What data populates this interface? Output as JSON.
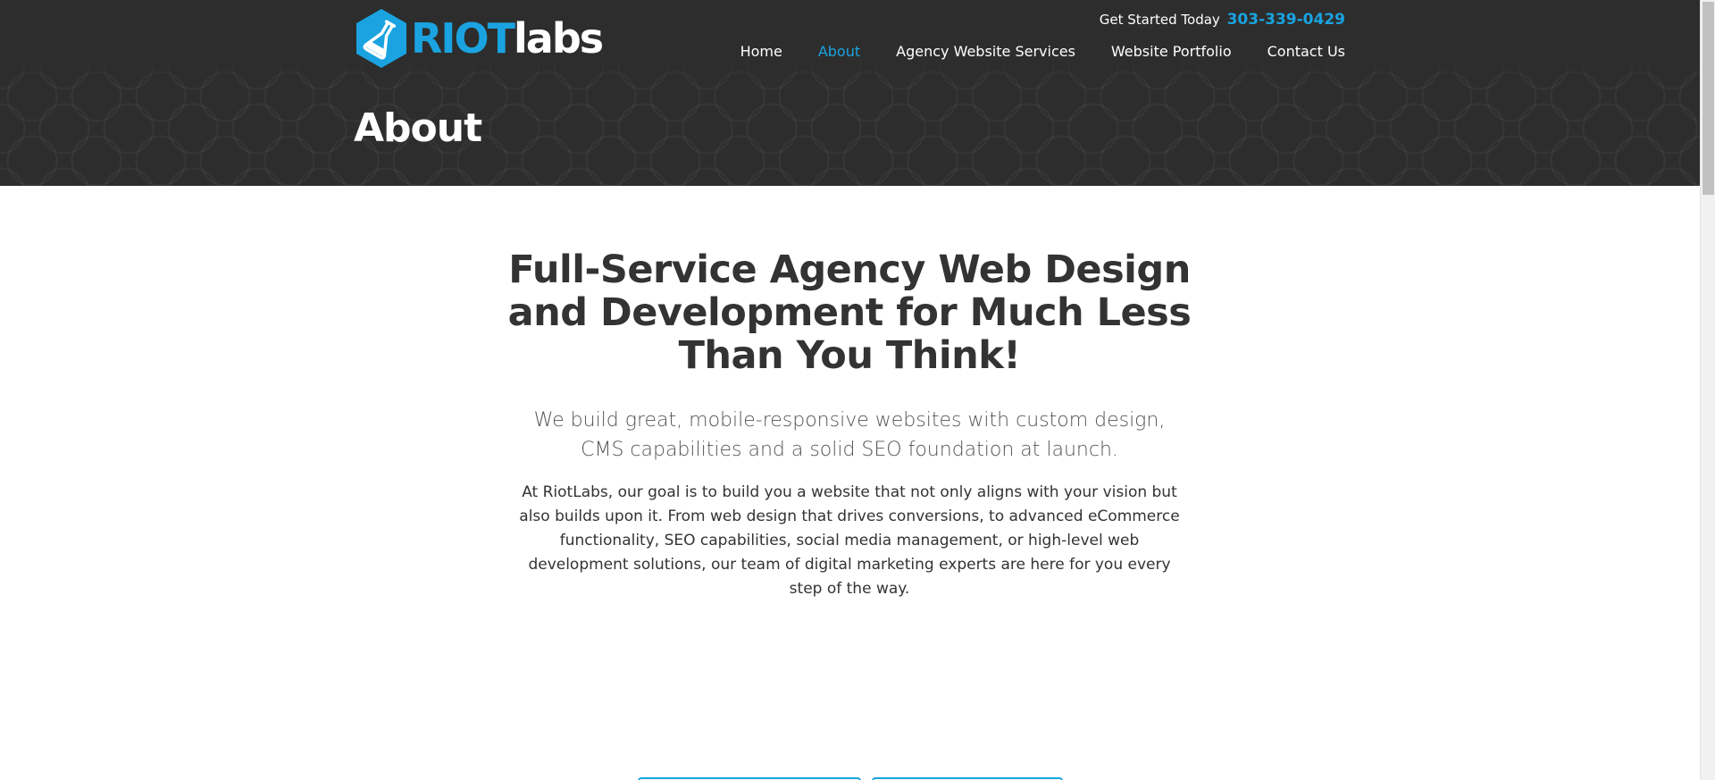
{
  "brand": {
    "logo_primary": "RIOT",
    "logo_secondary": "labs",
    "accent_color": "#1aa3e0",
    "header_bg": "#2d2d2d",
    "logo_icon": "flask-hexagon-icon"
  },
  "header": {
    "get_started_label": "Get Started Today",
    "phone": "303-339-0429",
    "nav": [
      {
        "label": "Home",
        "active": false
      },
      {
        "label": "About",
        "active": true
      },
      {
        "label": "Agency Website Services",
        "active": false
      },
      {
        "label": "Website Portfolio",
        "active": false
      },
      {
        "label": "Contact Us",
        "active": false
      }
    ]
  },
  "page": {
    "title": "About"
  },
  "main": {
    "headline": "Full-Service Agency Web Design and Development for Much Less Than You Think!",
    "subhead": "We build great, mobile-responsive websites with custom design, CMS capabilities and a solid SEO foundation at launch.",
    "body": "At RiotLabs, our goal is to build you a website that not only aligns with your vision but also builds upon it. From web design that drives conversions, to advanced eCommerce functionality, SEO capabilities, social media management, or high-level web development solutions, our team of digital marketing experts are here for you every step of the way."
  }
}
